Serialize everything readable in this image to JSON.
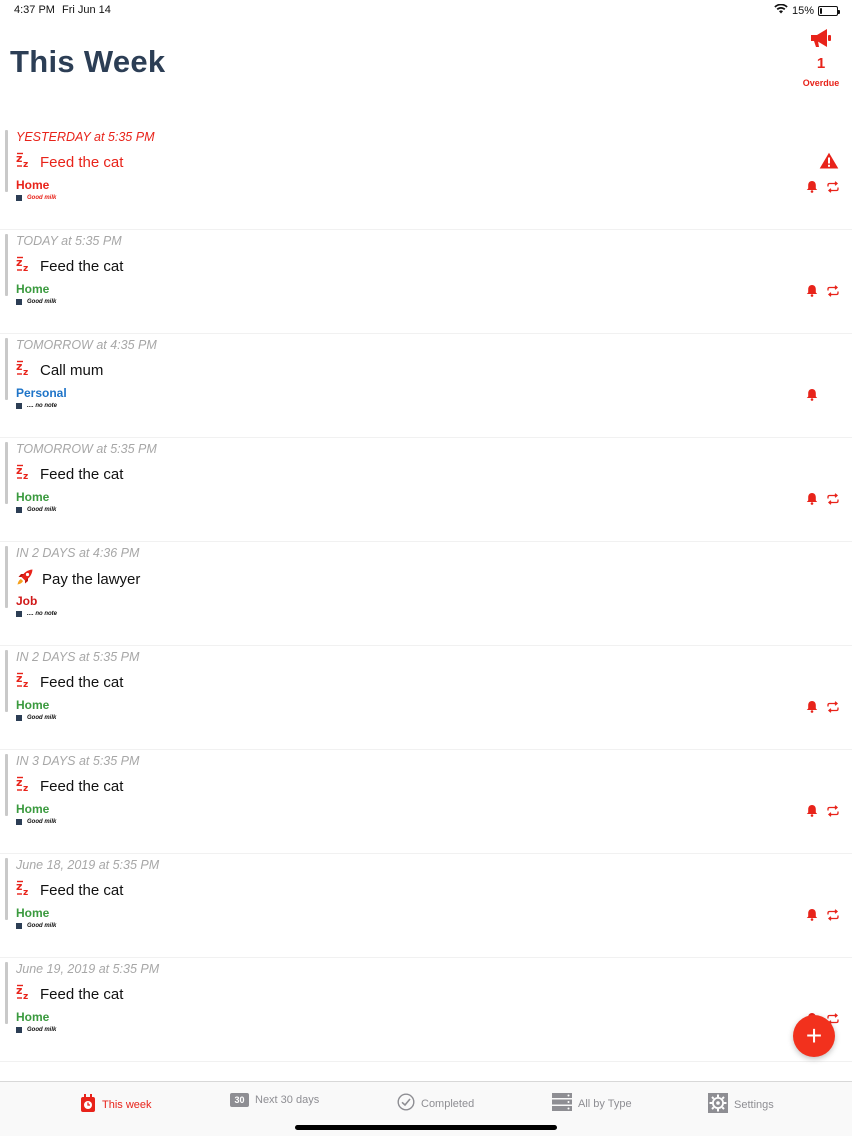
{
  "status": {
    "time": "4:37 PM",
    "date": "Fri Jun 14",
    "battery": "15%",
    "battery_level": 0.15
  },
  "header": {
    "title": "This Week",
    "overdue_count": "1",
    "overdue_label": "Overdue"
  },
  "items": [
    {
      "when": "YESTERDAY at 5:35 PM",
      "title": "Feed the cat",
      "category": "Home",
      "category_color": "#e8231a",
      "note": "Good milk",
      "icon": "sleep-zz-icon",
      "bell": true,
      "repeat": true,
      "warning": true,
      "overdue": true
    },
    {
      "when": "TODAY at 5:35 PM",
      "title": "Feed the cat",
      "category": "Home",
      "category_color": "#3a9a3e",
      "note": "Good milk",
      "icon": "sleep-zz-icon",
      "bell": true,
      "repeat": true,
      "warning": false,
      "overdue": false
    },
    {
      "when": "TOMORROW at 4:35 PM",
      "title": "Call mum",
      "category": "Personal",
      "category_color": "#1e74c8",
      "note": ".... no note",
      "icon": "sleep-zz-icon",
      "bell": true,
      "repeat": false,
      "warning": false,
      "overdue": false
    },
    {
      "when": "TOMORROW at 5:35 PM",
      "title": "Feed the cat",
      "category": "Home",
      "category_color": "#3a9a3e",
      "note": "Good milk",
      "icon": "sleep-zz-icon",
      "bell": true,
      "repeat": true,
      "warning": false,
      "overdue": false
    },
    {
      "when": "IN 2 DAYS at 4:36 PM",
      "title": "Pay the lawyer",
      "category": "Job",
      "category_color": "#d01818",
      "note": ".... no note",
      "icon": "rocket-icon",
      "bell": false,
      "repeat": false,
      "warning": false,
      "overdue": false
    },
    {
      "when": "IN 2 DAYS at 5:35 PM",
      "title": "Feed the cat",
      "category": "Home",
      "category_color": "#3a9a3e",
      "note": "Good milk",
      "icon": "sleep-zz-icon",
      "bell": true,
      "repeat": true,
      "warning": false,
      "overdue": false
    },
    {
      "when": "IN 3 DAYS at 5:35 PM",
      "title": "Feed the cat",
      "category": "Home",
      "category_color": "#3a9a3e",
      "note": "Good milk",
      "icon": "sleep-zz-icon",
      "bell": true,
      "repeat": true,
      "warning": false,
      "overdue": false
    },
    {
      "when": "June 18, 2019 at 5:35 PM",
      "title": "Feed the cat",
      "category": "Home",
      "category_color": "#3a9a3e",
      "note": "Good milk",
      "icon": "sleep-zz-icon",
      "bell": true,
      "repeat": true,
      "warning": false,
      "overdue": false
    },
    {
      "when": "June 19, 2019 at 5:35 PM",
      "title": "Feed the cat",
      "category": "Home",
      "category_color": "#3a9a3e",
      "note": "Good milk",
      "icon": "sleep-zz-icon",
      "bell": true,
      "repeat": true,
      "warning": false,
      "overdue": false
    }
  ],
  "fab": {
    "label": "+"
  },
  "tabs": [
    {
      "label": "This week",
      "icon": "calendar-week-icon",
      "active": true
    },
    {
      "label": "Next 30 days",
      "icon": "calendar-30-icon",
      "badge": "30",
      "active": false
    },
    {
      "label": "Completed",
      "icon": "check-circle-icon",
      "active": false
    },
    {
      "label": "All by Type",
      "icon": "server-stack-icon",
      "active": false
    },
    {
      "label": "Settings",
      "icon": "gear-icon",
      "active": false
    }
  ],
  "colors": {
    "accent": "#e8231a",
    "title": "#2c3e55",
    "muted": "#a7a7a7"
  }
}
